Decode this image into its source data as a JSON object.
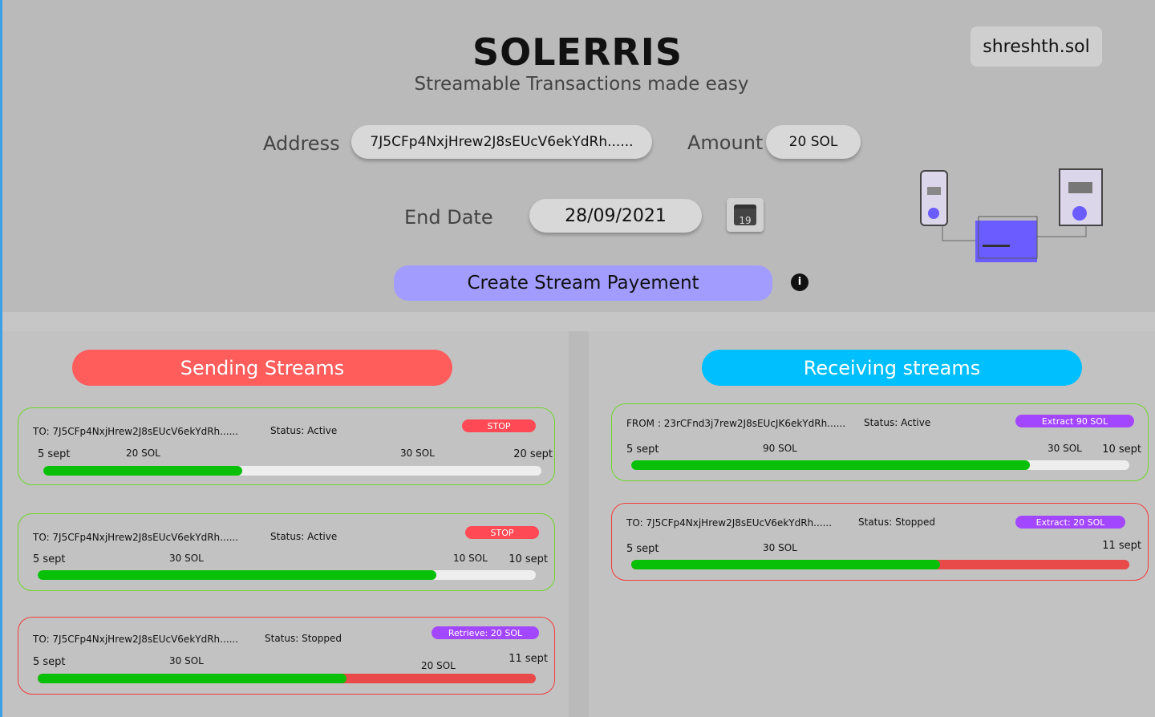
{
  "header": {
    "title": "SOLERRIS",
    "subtitle": "Streamable Transactions made easy",
    "wallet": "shreshth.sol"
  },
  "form": {
    "address_label": "Address",
    "address_value": "7J5CFp4NxjHrew2J8sEUcV6ekYdRh......",
    "amount_label": "Amount",
    "amount_value": "20 SOL",
    "end_date_label": "End Date",
    "end_date_value": "28/09/2021",
    "calendar_day": "19",
    "create_label": "Create Stream Payement",
    "info_icon": "i"
  },
  "colors": {
    "sending": "#ff5c5c",
    "receiving": "#00bfff",
    "create": "#a29cff",
    "progress": "#08c008",
    "stopped": "#e84a4a",
    "purple_btn": "#a346ff",
    "stop_btn": "#ff4a55"
  },
  "sending": {
    "title": "Sending Streams",
    "streams": [
      {
        "to": "TO: 7J5CFp4NxjHrew2J8sEUcV6ekYdRh......",
        "status": "Status: Active",
        "action": "STOP",
        "start": "5 sept",
        "streamed": "20 SOL",
        "total": "30  SOL",
        "end": "20 sept",
        "progress": 0.4
      },
      {
        "to": "TO: 7J5CFp4NxjHrew2J8sEUcV6ekYdRh......",
        "status": "Status: Active",
        "action": "STOP",
        "start": "5 sept",
        "streamed": "30  SOL",
        "total": "10 SOL",
        "end": "10 sept",
        "progress": 0.8
      },
      {
        "to": "TO: 7J5CFp4NxjHrew2J8sEUcV6ekYdRh......",
        "status": "Status: Stopped",
        "action": "Retrieve: 20 SOL",
        "start": "5 sept",
        "streamed": "30  SOL",
        "total": "20 SOL",
        "end": "11 sept",
        "progress": 0.62
      }
    ]
  },
  "receiving": {
    "title": "Receiving streams",
    "streams": [
      {
        "to": "FROM : 23rCFnd3j7rew2J8sEUcJK6ekYdRh......",
        "status": "Status: Active",
        "action": "Extract 90 SOL",
        "start": "5 sept",
        "streamed": "90  SOL",
        "total": "30 SOL",
        "end": "10 sept",
        "progress": 0.8
      },
      {
        "to": "TO: 7J5CFp4NxjHrew2J8sEUcV6ekYdRh......",
        "status": "Status: Stopped",
        "action": "Extract: 20 SOL",
        "start": "5 sept",
        "streamed": "30  SOL",
        "total": "",
        "end": "11 sept",
        "progress": 0.62
      }
    ]
  }
}
